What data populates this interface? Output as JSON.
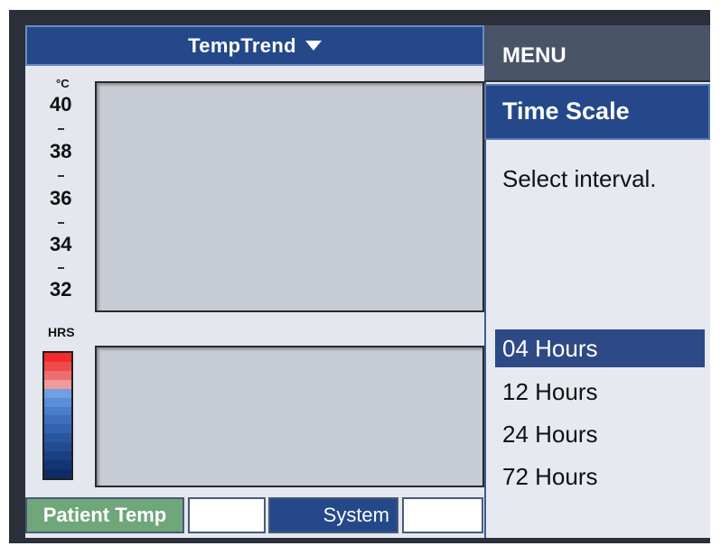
{
  "header": {
    "title": "TempTrend",
    "dropdown_icon": "caret-down-icon"
  },
  "scale": {
    "unit": "°C",
    "ticks": [
      "40",
      "38",
      "36",
      "34",
      "32"
    ]
  },
  "hrs_label": "HRS",
  "color_bar": {
    "colors": [
      "#f52a2a",
      "#f04a4a",
      "#ee6e6e",
      "#f09a9a",
      "#6fa0e0",
      "#5a8ed8",
      "#4a7dcc",
      "#3d6fbe",
      "#3363b0",
      "#2a56a0",
      "#224b92",
      "#1b3f82",
      "#143573",
      "#0f2c66"
    ]
  },
  "tabs": {
    "patient": "Patient Temp",
    "system": "System"
  },
  "menu": {
    "title": "MENU",
    "subtitle": "Time Scale",
    "prompt": "Select interval.",
    "options": [
      "04 Hours",
      "12 Hours",
      "24 Hours",
      "72 Hours"
    ],
    "selected": "04 Hours"
  },
  "colors": {
    "header_blue": "#24488a",
    "patient_tab_green": "#6fa67a",
    "menu_title_gray": "#4a5468"
  }
}
